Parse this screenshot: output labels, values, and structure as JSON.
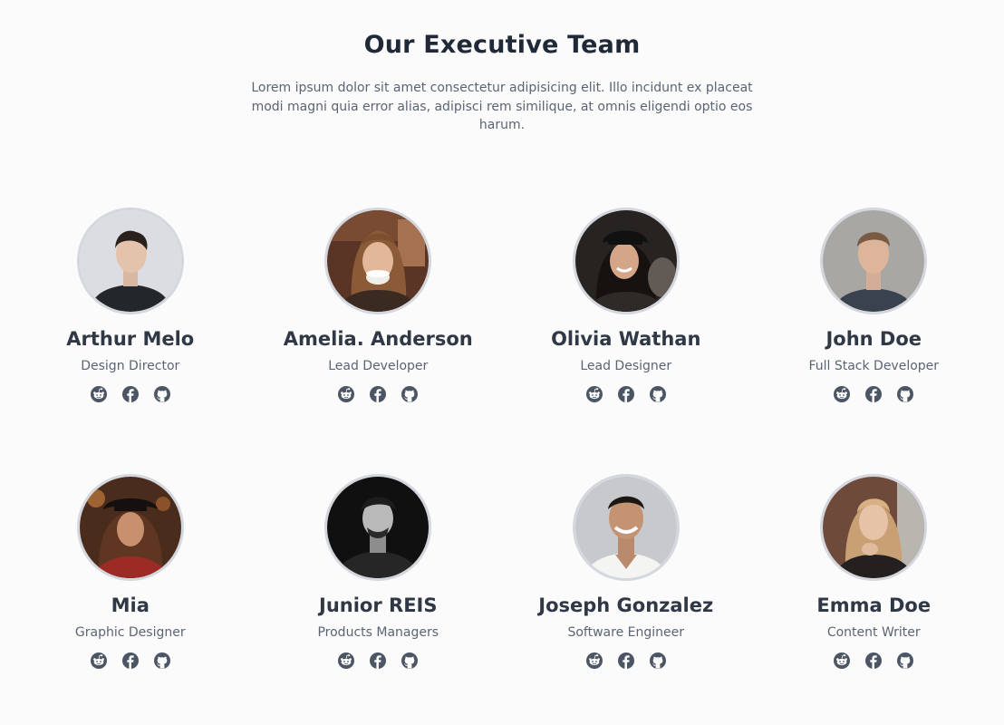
{
  "page": {
    "title": "Our Executive Team",
    "description": "Lorem ipsum dolor sit amet consectetur adipisicing elit. Illo incidunt ex placeat modi magni quia error alias, adipisci rem similique, at omnis eligendi optio eos harum."
  },
  "colors": {
    "background": "#fbfbfc",
    "heading": "#1f2937",
    "name": "#303846",
    "muted": "#5b6472",
    "icon": "#4b5563",
    "avatar_border": "#d4d7dd"
  },
  "social_icons": [
    "reddit-icon",
    "facebook-icon",
    "github-icon"
  ],
  "members": [
    {
      "name": "Arthur Melo",
      "role": "Design Director"
    },
    {
      "name": "Amelia. Anderson",
      "role": "Lead Developer"
    },
    {
      "name": "Olivia Wathan",
      "role": "Lead Designer"
    },
    {
      "name": "John Doe",
      "role": "Full Stack Developer"
    },
    {
      "name": "Mia",
      "role": "Graphic Designer"
    },
    {
      "name": "Junior REIS",
      "role": "Products Managers"
    },
    {
      "name": "Joseph Gonzalez",
      "role": "Software Engineer"
    },
    {
      "name": "Emma Doe",
      "role": "Content Writer"
    }
  ]
}
